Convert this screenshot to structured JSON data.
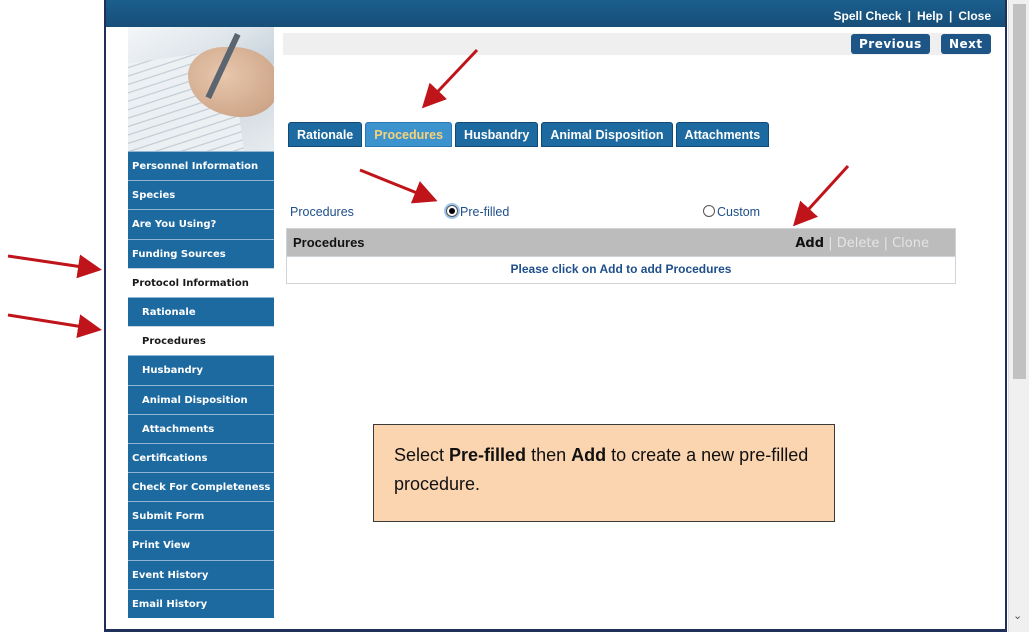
{
  "toplinks": {
    "spell_check": "Spell Check",
    "help": "Help",
    "close": "Close",
    "separator": "|"
  },
  "nav": {
    "previous": "Previous",
    "next": "Next"
  },
  "sidebar": {
    "items": [
      {
        "label": "Personnel Information"
      },
      {
        "label": "Species"
      },
      {
        "label": "Are You Using?"
      },
      {
        "label": "Funding Sources"
      },
      {
        "label": "Protocol Information",
        "active": true
      },
      {
        "label": "Rationale"
      },
      {
        "label": "Procedures",
        "active": true
      },
      {
        "label": "Husbandry"
      },
      {
        "label": "Animal Disposition"
      },
      {
        "label": "Attachments"
      },
      {
        "label": "Certifications"
      },
      {
        "label": "Check For Completeness"
      },
      {
        "label": "Submit Form"
      },
      {
        "label": "Print View"
      },
      {
        "label": "Event History"
      },
      {
        "label": "Email History"
      }
    ]
  },
  "tabs": [
    {
      "label": "Rationale"
    },
    {
      "label": "Procedures",
      "active": true
    },
    {
      "label": "Husbandry"
    },
    {
      "label": "Animal Disposition"
    },
    {
      "label": "Attachments"
    }
  ],
  "procedures_row": {
    "label": "Procedures",
    "option_prefilled": "Pre-filled",
    "option_custom": "Custom",
    "selected": "Pre-filled"
  },
  "table": {
    "title": "Procedures",
    "add": "Add",
    "delete": "Delete",
    "clone": "Clone",
    "separator": "|",
    "empty_message": "Please click on Add to add Procedures"
  },
  "callout": {
    "part1": "Select ",
    "bold1": "Pre-filled",
    "part2": " then ",
    "bold2": "Add",
    "part3": " to create a new pre-filled procedure."
  },
  "colors": {
    "header_blue": "#1b5e8e",
    "sidebar_blue": "#1d6aa0",
    "active_tab_text": "#f7d37a",
    "annotation_arrow": "#c0141b",
    "callout_bg": "#fbd4b0"
  }
}
